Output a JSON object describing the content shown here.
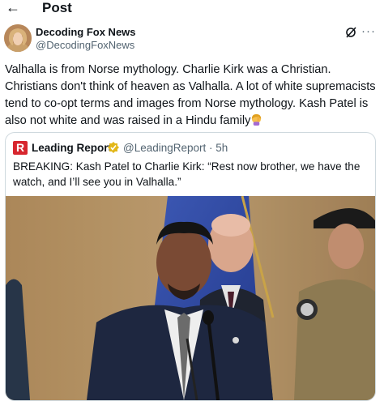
{
  "header": {
    "back_icon": "back-arrow-icon",
    "title": "Post"
  },
  "author": {
    "name": "Decoding Fox News",
    "handle": "@DecodingFoxNews"
  },
  "post": {
    "text": "Valhalla is from Norse mythology. Charlie Kirk was a Christian. Christians don't think of heaven as Valhalla.  A lot of white supremacists tend to co-opt terms and images from Norse mythology. Kash Patel is also not white and was raised in a Hindu family",
    "emoji": "woman-facepalming-emoji"
  },
  "quote": {
    "logo_letter": "R",
    "name": "Leading Report",
    "handle_time": "@LeadingReport · 5h",
    "text": "BREAKING: Kash Patel to Charlie Kirk: “Rest now brother, we have the watch, and I’ll see you in Valhalla.”"
  },
  "colors": {
    "text": "#0f1419",
    "secondary": "#536471",
    "border": "#cfd9de",
    "logo": "#d7262e",
    "verified": "#e2b719"
  }
}
